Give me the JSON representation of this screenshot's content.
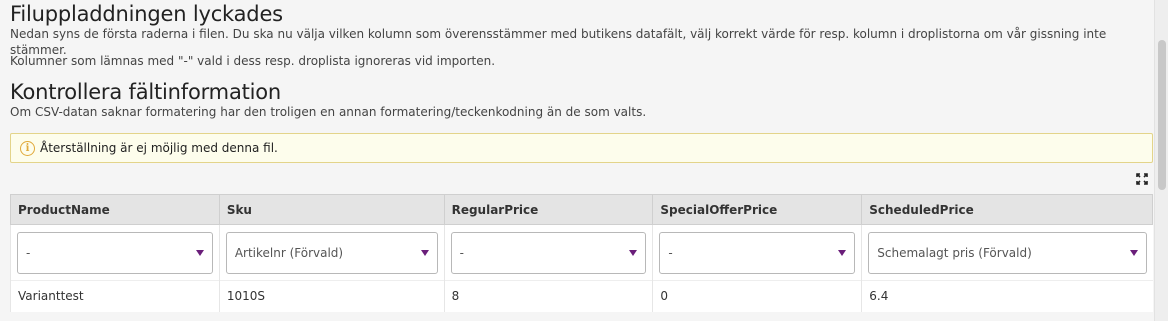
{
  "header": {
    "upload_title": "Filuppladdningen lyckades",
    "upload_desc": "Nedan syns de första raderna i filen. Du ska nu välja vilken kolumn som överensstämmer med butikens datafält, välj korrekt värde för resp. kolumn i droplistorna om vår gissning inte stämmer.",
    "ignore_note": "Kolumner som lämnas med \"-\" vald i dess resp. droplista ignoreras vid importen.",
    "check_title": "Kontrollera fältinformation",
    "check_desc": "Om CSV-datan saknar formatering har den troligen en annan formatering/teckenkodning än de som valts."
  },
  "notice": {
    "text": "Återställning är ej möjlig med denna fil.",
    "icon": "info-icon",
    "color": "#e0a93a"
  },
  "toolbar": {
    "expand_icon": "expand-icon"
  },
  "table": {
    "columns": [
      "ProductName",
      "Sku",
      "RegularPrice",
      "SpecialOfferPrice",
      "ScheduledPrice"
    ],
    "selects": [
      "-",
      "Artikelnr (Förvald)",
      "-",
      "-",
      "Schemalagt pris (Förvald)"
    ],
    "rows": [
      [
        "Varianttest",
        "1010S",
        "8",
        "0",
        "6.4"
      ]
    ]
  },
  "colors": {
    "accent": "#6a1e7a",
    "notice_border": "#e3d48a",
    "notice_bg": "#fdfdec"
  }
}
